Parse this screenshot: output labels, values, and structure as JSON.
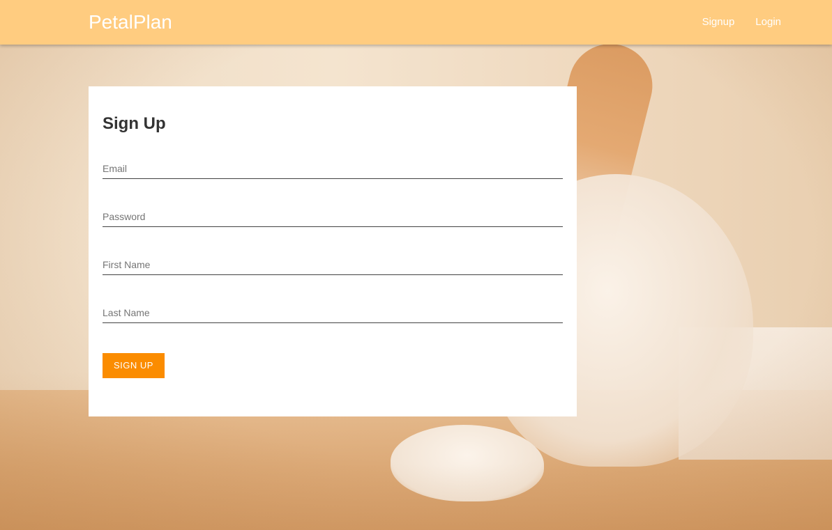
{
  "navbar": {
    "brand": "PetalPlan",
    "links": [
      {
        "label": "Signup"
      },
      {
        "label": "Login"
      }
    ],
    "background_color": "#ffcc80"
  },
  "form": {
    "title": "Sign Up",
    "fields": [
      {
        "name": "email",
        "placeholder": "Email",
        "value": ""
      },
      {
        "name": "password",
        "placeholder": "Password",
        "value": ""
      },
      {
        "name": "first_name",
        "placeholder": "First Name",
        "value": ""
      },
      {
        "name": "last_name",
        "placeholder": "Last Name",
        "value": ""
      }
    ],
    "submit_label": "SIGN UP",
    "submit_color": "#fb8c00"
  }
}
